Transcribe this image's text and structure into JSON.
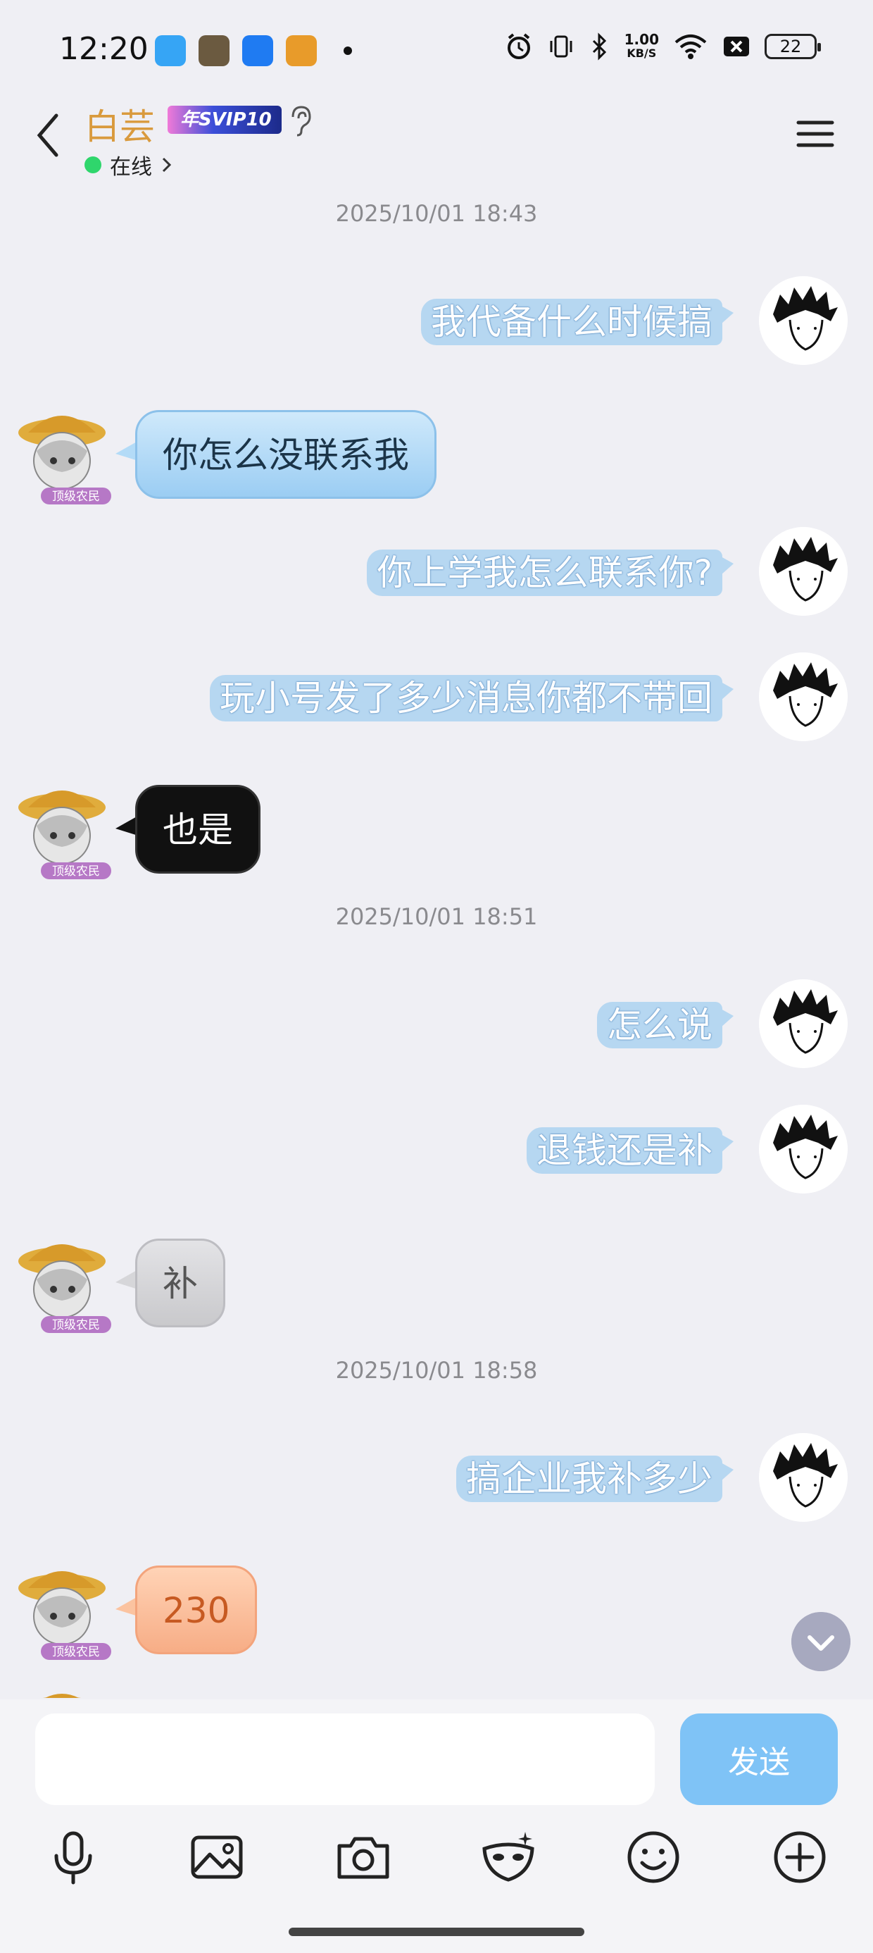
{
  "status_bar": {
    "time": "12:20",
    "net_speed_value": "1.00",
    "net_speed_unit": "KB/S",
    "battery": "22"
  },
  "header": {
    "contact_name": "白芸",
    "vip_badge": "年SVIP10",
    "presence": "在线"
  },
  "chat": {
    "timestamps": [
      "2025/10/01 18:43",
      "2025/10/01 18:51",
      "2025/10/01 18:58"
    ],
    "messages": [
      {
        "from": "me",
        "text": "我代备什么时候搞"
      },
      {
        "from": "other",
        "text": "你怎么没联系我",
        "style": "blue"
      },
      {
        "from": "me",
        "text": "你上学我怎么联系你?"
      },
      {
        "from": "me",
        "text": "玩小号发了多少消息你都不带回"
      },
      {
        "from": "other",
        "text": "也是",
        "style": "black"
      },
      {
        "from": "me",
        "text": "怎么说"
      },
      {
        "from": "me",
        "text": "退钱还是补"
      },
      {
        "from": "other",
        "text": "补",
        "style": "grey"
      },
      {
        "from": "me",
        "text": "搞企业我补多少"
      },
      {
        "from": "other",
        "text": "230",
        "style": "orange"
      }
    ],
    "avatar_badge": "顶级农民"
  },
  "input": {
    "placeholder": "",
    "send_label": "发送"
  },
  "icons": {
    "back": "back-arrow-icon",
    "menu": "hamburger-menu-icon",
    "ear": "ear-icon",
    "tools": [
      "microphone-icon",
      "image-icon",
      "camera-icon",
      "mask-icon",
      "emoji-icon",
      "plus-circle-icon"
    ]
  }
}
